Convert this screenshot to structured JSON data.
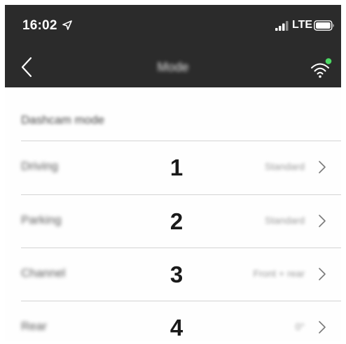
{
  "status_bar": {
    "time": "16:02",
    "network": "LTE"
  },
  "nav": {
    "title": "Mode",
    "wifi_status_color": "#4cd964"
  },
  "section": {
    "header": "Dashcam mode"
  },
  "rows": [
    {
      "label": "Driving",
      "number": "1",
      "value": "Standard"
    },
    {
      "label": "Parking",
      "number": "2",
      "value": "Standard"
    },
    {
      "label": "Channel",
      "number": "3",
      "value": "Front + rear"
    },
    {
      "label": "Rear",
      "number": "4",
      "value": "0°"
    }
  ],
  "icons": {
    "back": "chevron-left-icon",
    "wifi": "wifi-icon",
    "location": "location-arrow-icon",
    "signal": "cellular-signal-icon",
    "battery": "battery-icon",
    "row_chevron": "chevron-right-icon"
  }
}
